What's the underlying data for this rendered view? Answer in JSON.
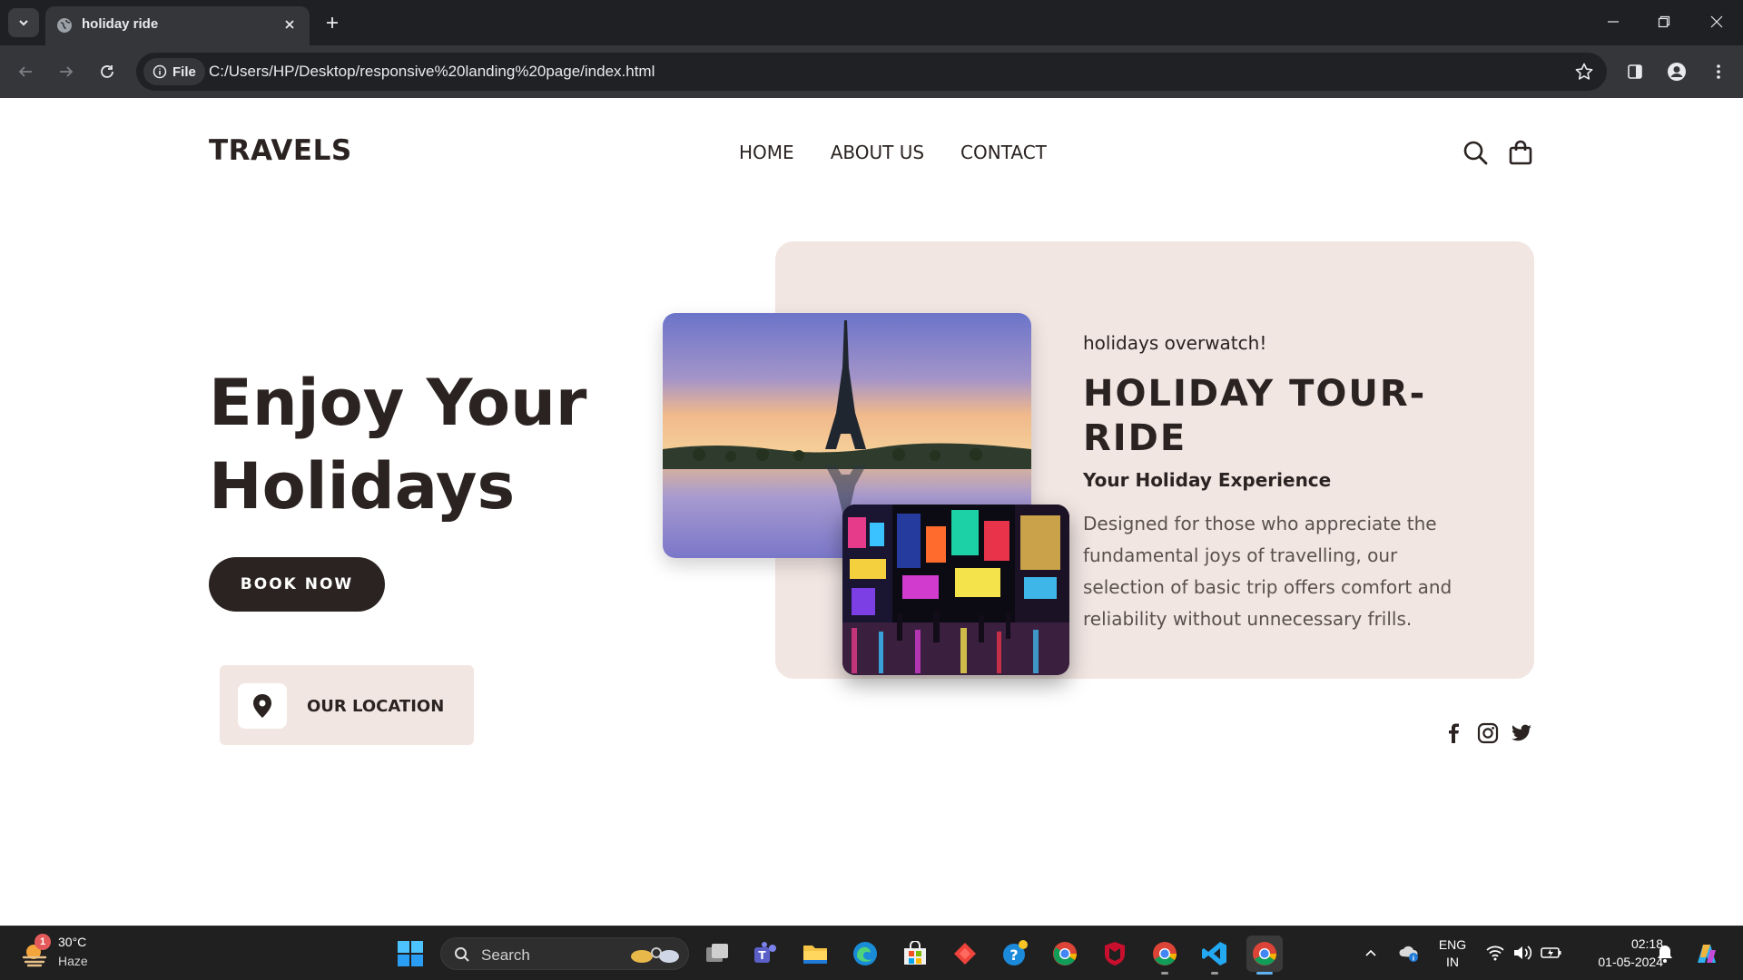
{
  "browser": {
    "tab_title": "holiday ride",
    "chip_label": "File",
    "url": "C:/Users/HP/Desktop/responsive%20landing%20page/index.html"
  },
  "site": {
    "brand": "TRAVELS",
    "nav": [
      "HOME",
      "ABOUT US",
      "CONTACT"
    ],
    "hero_line1": "Enjoy Your",
    "hero_line2": "Holidays",
    "book_button": "BOOK NOW",
    "location_label": "OUR LOCATION",
    "card": {
      "kicker": "holidays overwatch!",
      "title": "HOLIDAY TOUR-RIDE",
      "subtitle": "Your Holiday Experience",
      "body": "Designed for those who appreciate the fundamental joys of travelling, our selection of basic trip offers comfort and reliability without unnecessary frills."
    },
    "social": [
      "facebook-icon",
      "instagram-icon",
      "twitter-icon"
    ],
    "colors": {
      "dark": "#2a2321",
      "card_bg": "#f2e6e2",
      "text_muted": "#5a514d"
    }
  },
  "taskbar": {
    "weather_badge": "1",
    "weather_temp": "30°C",
    "weather_cond": "Haze",
    "search_label": "Search",
    "lang_top": "ENG",
    "lang_bottom": "IN",
    "time": "02:18",
    "date": "01-05-2024"
  }
}
